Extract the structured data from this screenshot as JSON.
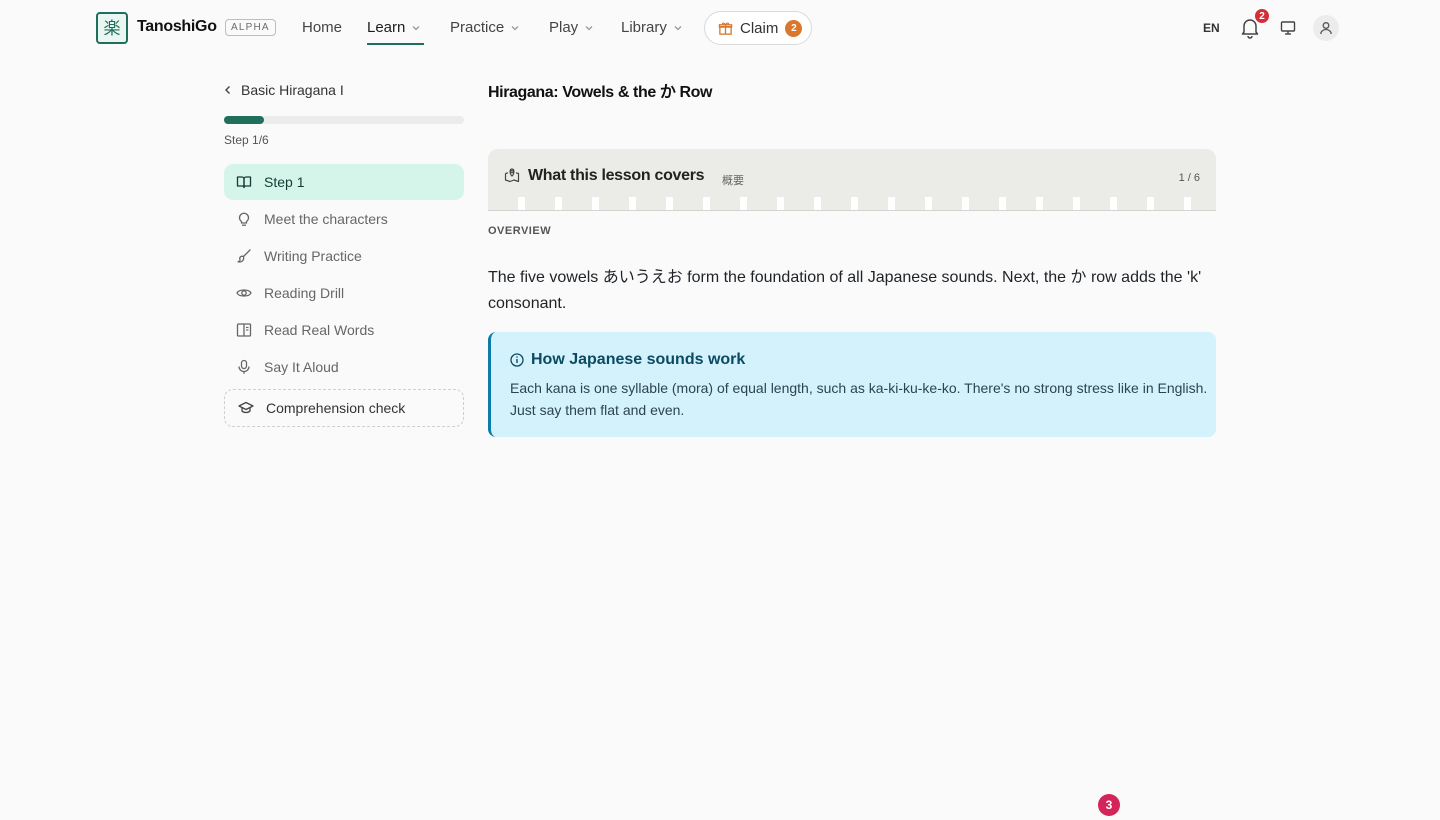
{
  "header": {
    "logo_glyph": "楽",
    "brand": "TanoshiGo",
    "badge": "ALPHA",
    "nav": [
      {
        "label": "Home"
      },
      {
        "label": "Learn"
      },
      {
        "label": "Practice"
      },
      {
        "label": "Play"
      },
      {
        "label": "Library"
      }
    ],
    "active_nav": "Learn",
    "claim_label": "Claim",
    "claim_count": "2",
    "language": "EN",
    "notification_count": "2"
  },
  "sidebar": {
    "back_label": "Basic Hiragana I",
    "progress_fraction": 0.1667,
    "step_count": "Step 1/6",
    "items": [
      {
        "label": "Step 1",
        "icon": "book-open-icon"
      },
      {
        "label": "Meet the characters",
        "icon": "lightbulb-icon"
      },
      {
        "label": "Writing Practice",
        "icon": "brush-icon"
      },
      {
        "label": "Reading Drill",
        "icon": "eye-icon"
      },
      {
        "label": "Read Real Words",
        "icon": "book-layout-icon"
      },
      {
        "label": "Say It Aloud",
        "icon": "microphone-icon"
      },
      {
        "label": "Comprehension check",
        "icon": "graduation-cap-icon"
      }
    ]
  },
  "main": {
    "lesson_title": "Hiragana: Vowels & the か Row",
    "card": {
      "title": "What this lesson covers",
      "subtitle_jp": "概要",
      "pager": "1 / 6"
    },
    "overview_label": "OVERVIEW",
    "overview_text": "The five vowels あいうえお form the foundation of all Japanese sounds. Next, the か row adds the 'k' consonant.",
    "note": {
      "heading": "How Japanese sounds work",
      "body": "Each kana is one syllable (mora) of equal length, such as ka-ki-ku-ke-ko. There's no strong stress like in English. Just say them flat and even."
    }
  },
  "floating_badge": "3",
  "colors": {
    "brand": "#1f6f5c",
    "active_item_bg": "#d6f5ea",
    "note_bg": "#d4f2fb",
    "note_accent": "#0e7aa8",
    "claim_badge": "#d9772e",
    "notification_badge": "#d32f3a",
    "floating_badge": "#d3255a"
  }
}
